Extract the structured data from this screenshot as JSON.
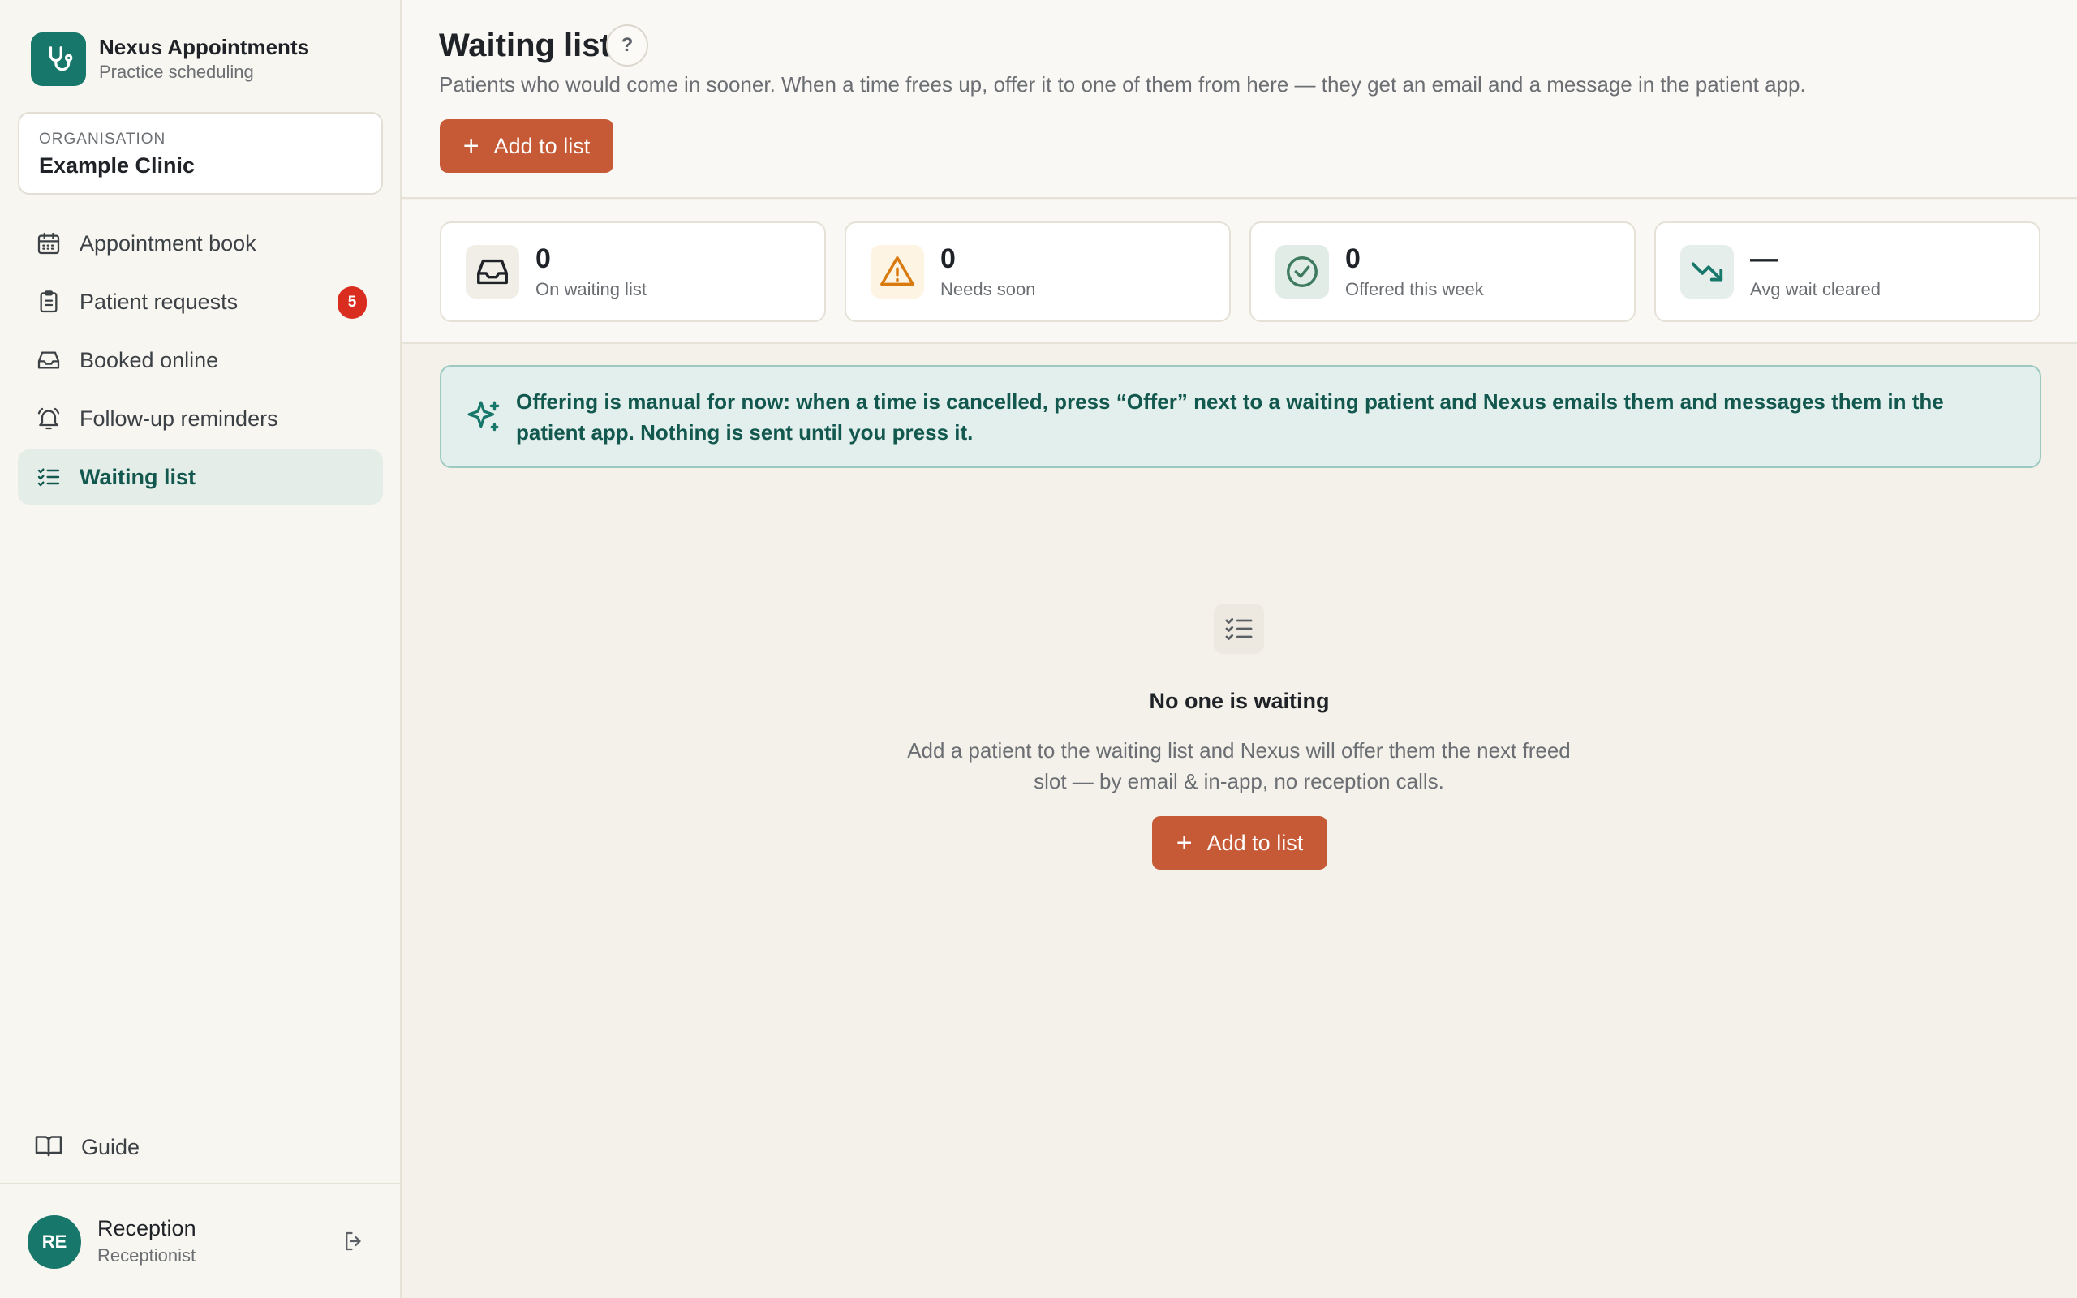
{
  "brand": {
    "title": "Nexus Appointments",
    "subtitle": "Practice scheduling",
    "icon": "stethoscope-icon"
  },
  "organisation": {
    "label": "ORGANISATION",
    "name": "Example Clinic"
  },
  "nav": {
    "items": [
      {
        "label": "Appointment book",
        "icon": "calendar-icon"
      },
      {
        "label": "Patient requests",
        "icon": "clipboard-icon",
        "badge": "5"
      },
      {
        "label": "Booked online",
        "icon": "inbox-icon"
      },
      {
        "label": "Follow-up reminders",
        "icon": "bell-icon"
      },
      {
        "label": "Waiting list",
        "icon": "checklist-icon",
        "active": true
      }
    ],
    "guide": {
      "label": "Guide",
      "icon": "book-icon"
    }
  },
  "user": {
    "initials": "RE",
    "name": "Reception",
    "role": "Receptionist"
  },
  "header": {
    "title": "Waiting list",
    "help": "?",
    "description": "Patients who would come in sooner. When a time frees up, offer it to one of them from here — they get an email and a message in the patient app.",
    "add_button": "Add to list"
  },
  "stats": [
    {
      "value": "0",
      "label": "On waiting list",
      "icon": "inbox-icon"
    },
    {
      "value": "0",
      "label": "Needs soon",
      "icon": "warning-icon"
    },
    {
      "value": "0",
      "label": "Offered this week",
      "icon": "check-circle-icon"
    },
    {
      "value": "—",
      "label": "Avg wait cleared",
      "icon": "trending-down-icon"
    }
  ],
  "notice": {
    "text": "Offering is manual for now: when a time is cancelled, press “Offer” next to a waiting patient and Nexus emails them and messages them in the patient app. Nothing is sent until you press it.",
    "icon": "sparkle-icon"
  },
  "empty_state": {
    "title": "No one is waiting",
    "description": "Add a patient to the waiting list and Nexus will offer them the next freed slot — by email & in-app, no reception calls.",
    "button": "Add to list",
    "icon": "checklist-icon"
  },
  "colors": {
    "brand_teal": "#17776a",
    "accent_orange": "#c65a36",
    "badge_red": "#d92d20",
    "warning": "#d97a0f",
    "active_nav_bg": "#e4ede8"
  }
}
